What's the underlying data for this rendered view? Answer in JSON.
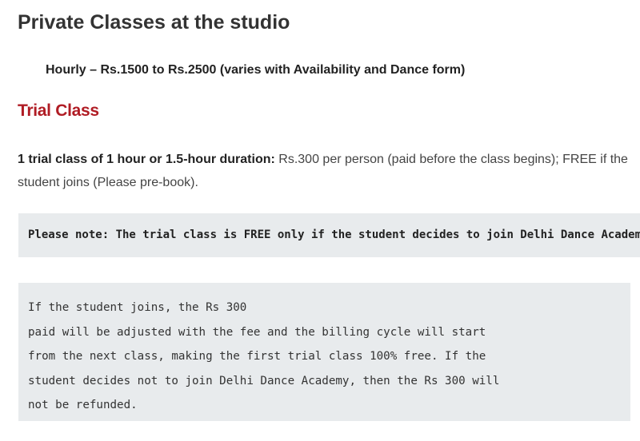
{
  "private_classes": {
    "heading": "Private Classes at the studio",
    "pricing": "Hourly – Rs.1500 to Rs.2500 (varies with Availability and Dance form)"
  },
  "trial_class": {
    "heading": "Trial Class",
    "desc_bold": "1 trial class of 1 hour or 1.5-hour duration:",
    "desc_rest": " Rs.300 per person (paid before the class begins); FREE if the student joins (Please pre-book)."
  },
  "note": {
    "text": "Please note: The trial class is FREE only if the student decides to join Delhi Dance Academy."
  },
  "detail": {
    "lines": [
      "If the student joins, the Rs 300",
      "paid will be adjusted with the fee and the billing cycle will start",
      "from the next class, making the first trial class 100% free. If the",
      "student decides not to join Delhi Dance Academy, then the Rs 300 will",
      "not be refunded."
    ]
  }
}
